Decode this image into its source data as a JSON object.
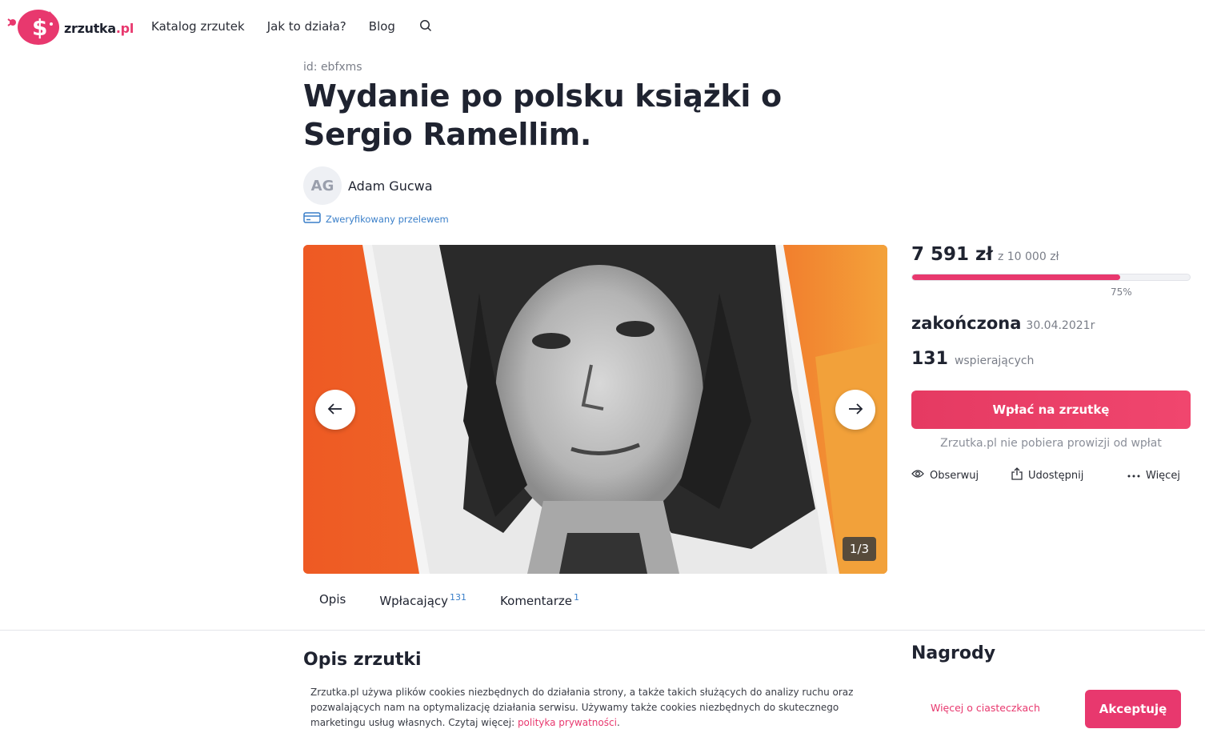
{
  "header": {
    "logo_text": "zrzutka",
    "logo_suffix": ".pl",
    "nav": [
      "Katalog zrzutek",
      "Jak to działa?",
      "Blog"
    ]
  },
  "campaign": {
    "id_line": "id: ebfxms",
    "title": "Wydanie po polsku książki o Sergio Ramellim.",
    "author_initials": "AG",
    "author_name": "Adam Gucwa",
    "verified": "Zweryfikowany przelewem",
    "gallery_counter": "1/3"
  },
  "tabs": [
    {
      "label": "Opis",
      "count": ""
    },
    {
      "label": "Wpłacający",
      "count": "131"
    },
    {
      "label": "Komentarze",
      "count": "1"
    }
  ],
  "sidebar": {
    "raised": "7 591 zł",
    "goal": "z 10 000 zł",
    "progress_fraction": 0.75,
    "progress_label": "75%",
    "status": "zakończona",
    "status_date": "30.04.2021r",
    "backers_count": "131",
    "backers_label": "wspierających",
    "donate_label": "Wpłać na zrzutkę",
    "fee_note": "Zrzutka.pl nie pobiera prowizji od wpłat",
    "actions": [
      "Obserwuj",
      "Udostępnij",
      "Więcej"
    ]
  },
  "sections": {
    "opis_title": "Opis zrzutki",
    "nagrody_title": "Nagrody"
  },
  "cookie": {
    "text_before": "Zrzutka.pl używa plików cookies niezbędnych do działania strony, a także takich służących do analizy ruchu oraz pozwalających nam na optymalizację działania serwisu. Używamy także cookies niezbędnych do skutecznego marketingu usług własnych. Czytaj więcej: ",
    "link": "polityka prywatności",
    "text_after": ".",
    "more": "Więcej o ciasteczkach",
    "accept": "Akceptuję"
  },
  "colors": {
    "brand": "#e8386e",
    "link": "#3a7fc9"
  }
}
